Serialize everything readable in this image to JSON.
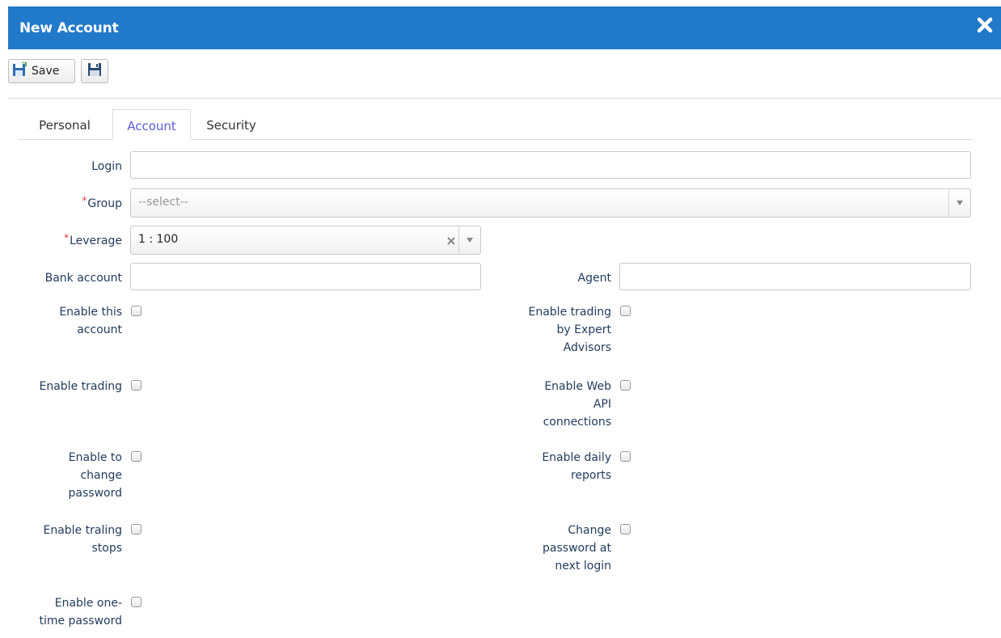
{
  "window": {
    "title": "New Account"
  },
  "toolbar": {
    "save_label": "Save"
  },
  "tabs": [
    "Personal",
    "Account",
    "Security"
  ],
  "form": {
    "login": {
      "label": "Login",
      "value": ""
    },
    "group": {
      "label": "Group",
      "placeholder": "--select--"
    },
    "leverage": {
      "label": "Leverage",
      "value": "1 : 100"
    },
    "bank_account": {
      "label": "Bank account",
      "value": ""
    },
    "agent": {
      "label": "Agent",
      "value": ""
    }
  },
  "checkboxes_left": [
    {
      "lines": [
        "Enable this",
        "account"
      ],
      "checked": false
    },
    {
      "lines": [
        "Enable trading"
      ],
      "checked": false
    },
    {
      "lines": [
        "Enable to",
        "change",
        "password"
      ],
      "checked": false
    },
    {
      "lines": [
        "Enable traling",
        "stops"
      ],
      "checked": false
    },
    {
      "lines": [
        "Enable one-",
        "time password"
      ],
      "checked": false
    }
  ],
  "checkboxes_right": [
    {
      "lines": [
        "Enable trading",
        "by Expert",
        "Advisors"
      ],
      "checked": false
    },
    {
      "lines": [
        "Enable Web",
        "API",
        "connections"
      ],
      "checked": false
    },
    {
      "lines": [
        "Enable daily",
        "reports"
      ],
      "checked": false
    },
    {
      "lines": [
        "Change",
        "password at",
        "next login"
      ],
      "checked": false
    }
  ],
  "colors": {
    "titlebar": "#2179c9",
    "active_tab": "#5b5bd6",
    "label": "#1f3b5b",
    "required": "#e03a3a"
  }
}
